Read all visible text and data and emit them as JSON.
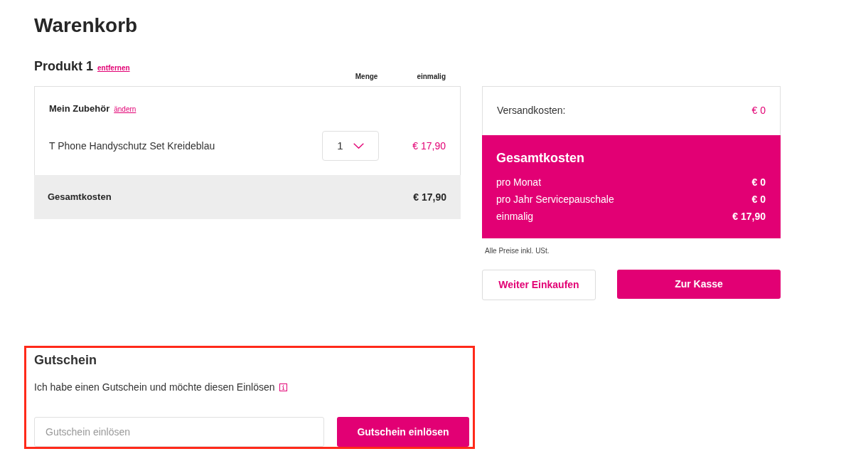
{
  "page": {
    "title": "Warenkorb"
  },
  "product": {
    "title": "Produkt 1",
    "remove_link": "entfernen",
    "columns": [
      "Menge",
      "einmalig"
    ],
    "group": {
      "title": "Mein Zubehör",
      "change_link": "ändern"
    },
    "items": [
      {
        "name": "T Phone Handyschutz Set Kreideblau",
        "quantity": "1",
        "price": "€ 17,90"
      }
    ],
    "total": {
      "label": "Gesamtkosten",
      "value": "€ 17,90"
    }
  },
  "summary": {
    "shipping": {
      "label": "Versandkosten:",
      "value": "€ 0"
    },
    "total": {
      "title": "Gesamtkosten",
      "rows": [
        {
          "label": "pro Monat",
          "value": "€ 0"
        },
        {
          "label": "pro Jahr Servicepauschale",
          "value": "€ 0"
        },
        {
          "label": "einmalig",
          "value": "€ 17,90"
        }
      ]
    },
    "note": "Alle Preise inkl. USt.",
    "buttons": [
      {
        "label": "Weiter Einkaufen",
        "kind": "secondary"
      },
      {
        "label": "Zur Kasse",
        "kind": "primary"
      }
    ]
  },
  "coupon": {
    "title": "Gutschein",
    "text": "Ich habe einen Gutschein und möchte diesen Einlösen",
    "input": {
      "placeholder": "Gutschein einlösen"
    },
    "button": "Gutschein einlösen",
    "highlighted": true
  }
}
